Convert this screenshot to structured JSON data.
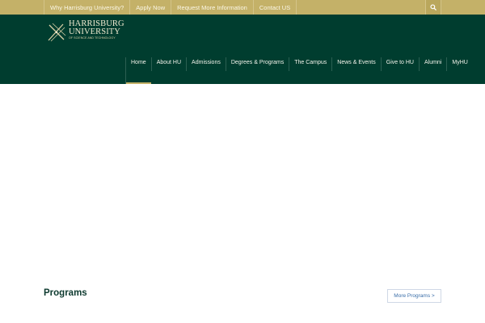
{
  "topbar": {
    "links": [
      {
        "label": "Why Harrisburg University?"
      },
      {
        "label": "Apply Now"
      },
      {
        "label": "Request More Information"
      },
      {
        "label": "Contact US"
      }
    ],
    "search_icon": "search-icon"
  },
  "logo": {
    "line1": "HARRISBURG",
    "line2": "UNIVERSITY",
    "tagline": "OF SCIENCE AND TECHNOLOGY"
  },
  "nav": {
    "items": [
      {
        "label": "Home",
        "active": true
      },
      {
        "label": "About HU"
      },
      {
        "label": "Admissions"
      },
      {
        "label": "Degrees & Programs"
      },
      {
        "label": "The Campus"
      },
      {
        "label": "News & Events"
      },
      {
        "label": "Give to HU"
      },
      {
        "label": "Alumni"
      },
      {
        "label": "MyHU"
      }
    ]
  },
  "programs": {
    "title": "Programs",
    "more_label": "More Programs >"
  },
  "colors": {
    "topbar": "#c4b168",
    "header": "#003d2f",
    "accent": "#c4b168"
  }
}
